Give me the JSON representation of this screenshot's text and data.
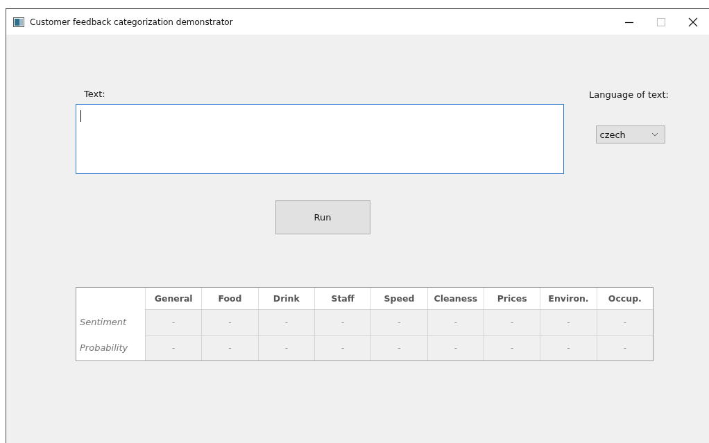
{
  "window": {
    "title": "Customer feedback categorization demonstrator"
  },
  "text_input": {
    "label": "Text:",
    "focused": true
  },
  "language": {
    "label": "Language of text:",
    "value": "czech"
  },
  "run_button": {
    "label": "Run"
  },
  "table": {
    "columns": [
      "General",
      "Food",
      "Drink",
      "Staff",
      "Speed",
      "Cleaness",
      "Prices",
      "Environ.",
      "Occup."
    ],
    "rows": [
      {
        "header": "Sentiment",
        "cells": [
          "-",
          "-",
          "-",
          "-",
          "-",
          "-",
          "-",
          "-",
          "-"
        ]
      },
      {
        "header": "Probability",
        "cells": [
          "-",
          "-",
          "-",
          "-",
          "-",
          "-",
          "-",
          "-",
          "-"
        ]
      }
    ]
  }
}
